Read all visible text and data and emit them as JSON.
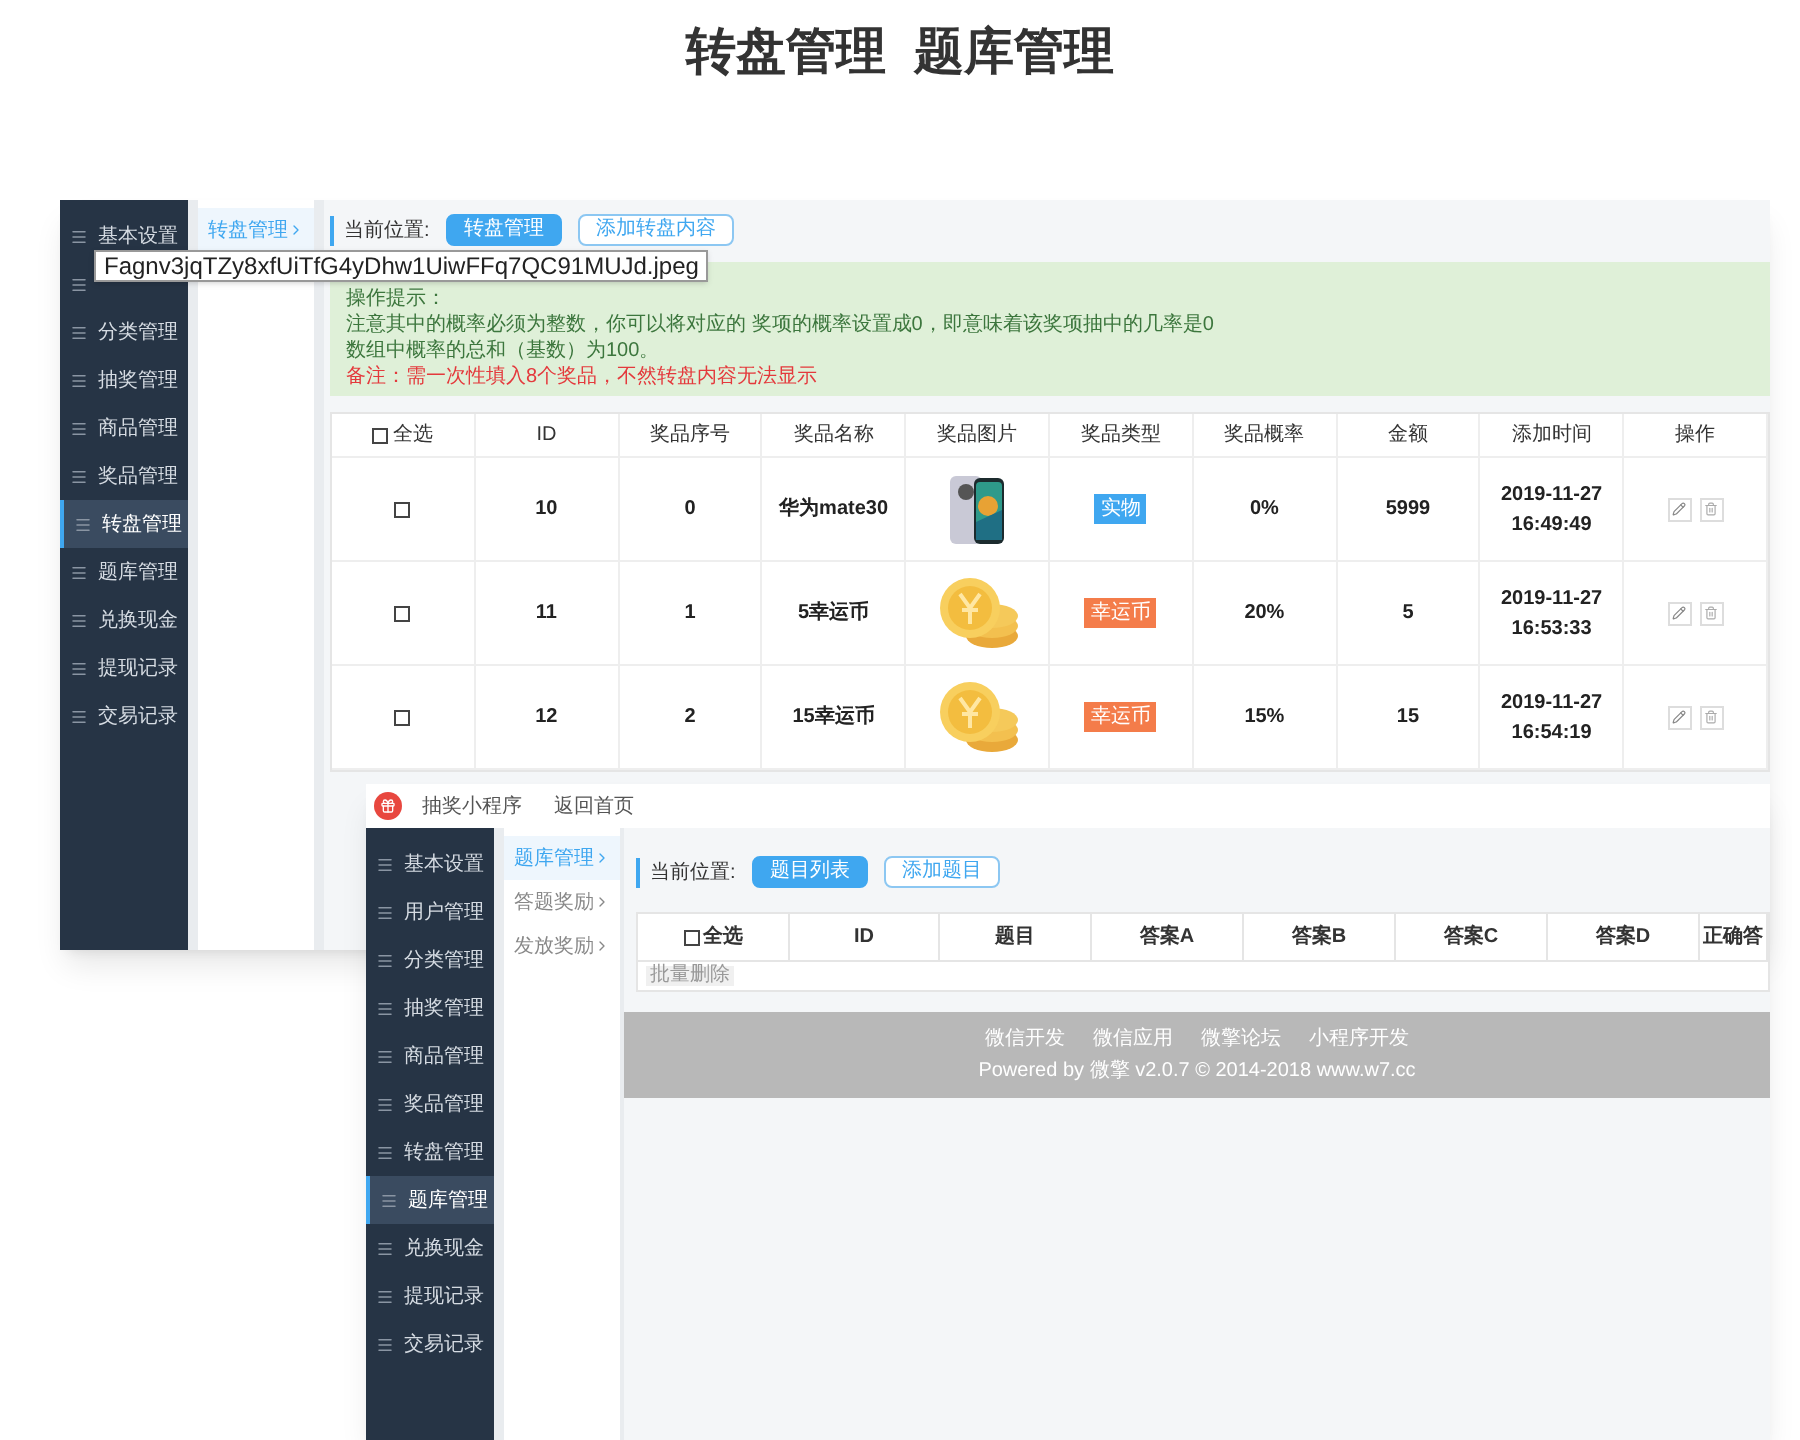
{
  "heading": [
    "转盘管理",
    "题库管理"
  ],
  "tooltip": "Fagnv3jqTZy8xfUiTfG4yDhw1UiwFFq7QC91MUJd.jpeg",
  "window_1": {
    "sidebar": [
      {
        "label": "基本设置",
        "selected": false
      },
      {
        "selected": false
      },
      {
        "label": "分类管理",
        "selected": false
      },
      {
        "label": "抽奖管理",
        "selected": false
      },
      {
        "label": "商品管理",
        "selected": false
      },
      {
        "label": "奖品管理",
        "selected": false
      },
      {
        "label": "转盘管理",
        "selected": true
      },
      {
        "label": "题库管理",
        "selected": false
      },
      {
        "label": "兑换现金",
        "selected": false
      },
      {
        "label": "提现记录",
        "selected": false
      },
      {
        "label": "交易记录",
        "selected": false
      }
    ],
    "subnav": [
      {
        "label": "转盘管理",
        "selected": true
      }
    ],
    "breadcrumb_label": "当前位置:",
    "buttons": [
      {
        "label": "转盘管理",
        "selected": true
      },
      {
        "label": "添加转盘内容",
        "selected": false
      }
    ],
    "notice": {
      "title": "操作提示：",
      "lines": [
        "注意其中的概率必须为整数，你可以将对应的 奖项的概率设置成0，即意味着该奖项抽中的几率是0",
        "数组中概率的总和（基数）为100。"
      ],
      "remark": "备注：需一次性填入8个奖品，不然转盘内容无法显示"
    },
    "table": {
      "select_all": {
        "label": "全选",
        "checked": false
      },
      "columns": [
        "ID",
        "奖品序号",
        "奖品名称",
        "奖品图片",
        "奖品类型",
        "奖品概率",
        "金额",
        "添加时间",
        "操作"
      ],
      "rows": [
        {
          "checked": false,
          "id": "10",
          "index": "0",
          "name": "华为mate30",
          "type": "实物",
          "color": "#3fa7f0",
          "rate": "0%",
          "amount": "5999",
          "date": "2019-11-27",
          "time": "16:49:49"
        },
        {
          "checked": false,
          "id": "11",
          "index": "1",
          "name": "5幸运币",
          "type": "幸运币",
          "color": "#f47c4a",
          "rate": "20%",
          "amount": "5",
          "date": "2019-11-27",
          "time": "16:53:33"
        },
        {
          "checked": false,
          "id": "12",
          "index": "2",
          "name": "15幸运币",
          "type": "幸运币",
          "color": "#f47c4a",
          "rate": "15%",
          "amount": "15",
          "date": "2019-11-27",
          "time": "16:54:19"
        }
      ]
    }
  },
  "window_2": {
    "app_name": "抽奖小程序",
    "home_link": "返回首页",
    "sidebar": [
      {
        "label": "基本设置",
        "selected": false
      },
      {
        "label": "用户管理",
        "selected": false
      },
      {
        "label": "分类管理",
        "selected": false
      },
      {
        "label": "抽奖管理",
        "selected": false
      },
      {
        "label": "商品管理",
        "selected": false
      },
      {
        "label": "奖品管理",
        "selected": false
      },
      {
        "label": "转盘管理",
        "selected": false
      },
      {
        "label": "题库管理",
        "selected": true
      },
      {
        "label": "兑换现金",
        "selected": false
      },
      {
        "label": "提现记录",
        "selected": false
      },
      {
        "label": "交易记录",
        "selected": false
      }
    ],
    "subnav": [
      {
        "label": "题库管理",
        "selected": true
      },
      {
        "label": "答题奖励",
        "selected": false
      },
      {
        "label": "发放奖励",
        "selected": false
      }
    ],
    "breadcrumb_label": "当前位置:",
    "buttons": [
      {
        "label": "题目列表",
        "selected": true
      },
      {
        "label": "添加题目",
        "selected": false
      }
    ],
    "table": {
      "select_all": {
        "label": "全选",
        "checked": false
      },
      "columns": [
        "ID",
        "题目",
        "答案A",
        "答案B",
        "答案C",
        "答案D",
        "正确答"
      ]
    },
    "batch_delete": "批量删除",
    "footer": {
      "links": [
        "微信开发",
        "微信应用",
        "微擎论坛",
        "小程序开发"
      ],
      "powered": "Powered by 微擎 v2.0.7 © 2014-2018 www.w7.cc"
    }
  }
}
